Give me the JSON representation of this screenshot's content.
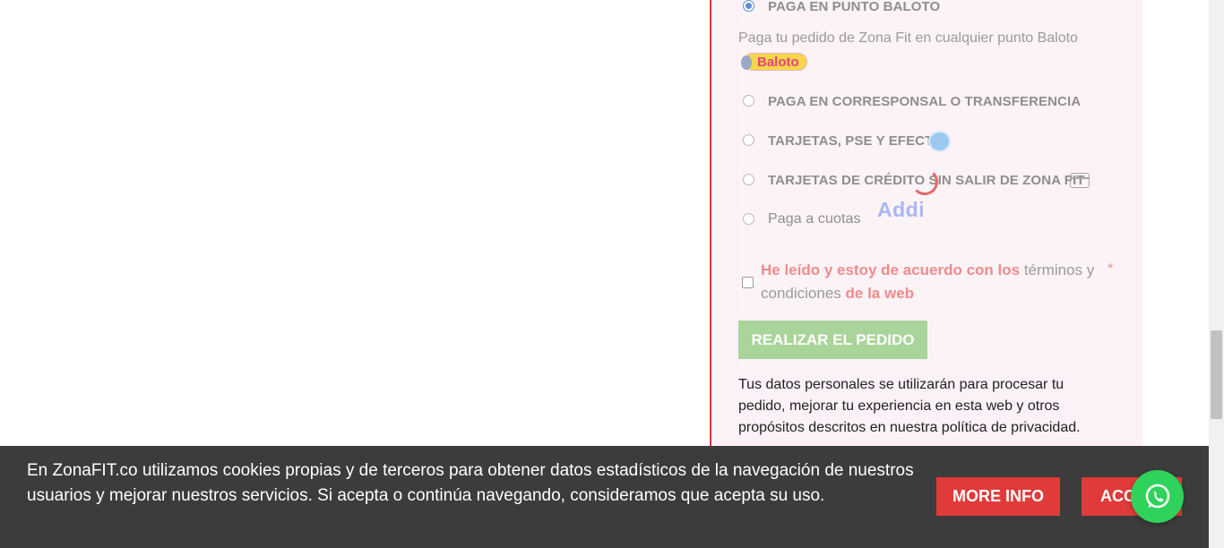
{
  "payment": {
    "options": [
      {
        "label": "PAGA EN PUNTO BALOTO",
        "checked": true
      },
      {
        "label": "PAGA EN CORRESPONSAL O TRANSFERENCIA",
        "checked": false
      },
      {
        "label": "TARJETAS, PSE Y EFECTY",
        "checked": false
      },
      {
        "label": "TARJETAS DE CRÉDITO SIN SALIR DE ZONA FIT",
        "checked": false
      },
      {
        "label": "Paga a cuotas",
        "checked": false
      }
    ],
    "baloto_description": "Paga tu pedido de Zona Fit en cualquier punto Baloto",
    "baloto_logo_text": "Baloto",
    "addi_logo_text": "Addi"
  },
  "terms": {
    "part1": "He leído y estoy de acuerdo con los ",
    "part2": "términos y condiciones",
    "part3": " de la web",
    "required_mark": "*"
  },
  "place_order_label": "REALIZAR EL PEDIDO",
  "privacy": {
    "text": "Tus datos personales se utilizarán para procesar tu pedido, mejorar tu experiencia en esta web y otros propósitos descritos en nuestra ",
    "link": "política de privacidad",
    "end": "."
  },
  "cookie": {
    "text": "En ZonaFIT.co utilizamos cookies propias y de terceros para obtener datos estadísticos de la navegación de nuestros usuarios y mejorar nuestros servicios. Si acepta o continúa navegando, consideramos que acepta su uso.",
    "more_info": "MORE INFO",
    "accept": "ACCEPT"
  },
  "colors": {
    "accent_red": "#e03a3a",
    "place_order_green": "#a9d49a",
    "whatsapp_green": "#2fd25a"
  }
}
